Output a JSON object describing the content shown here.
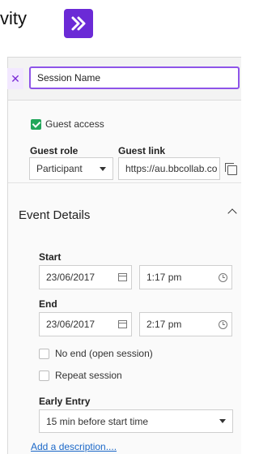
{
  "header": {
    "title_fragment": "vity"
  },
  "session": {
    "name_value": "Session Name"
  },
  "guest": {
    "access_label": "Guest access",
    "role_label": "Guest role",
    "role_value": "Participant",
    "link_label": "Guest link",
    "link_value": "https://au.bbcollab.co"
  },
  "event": {
    "title": "Event Details",
    "start_label": "Start",
    "start_date": "23/06/2017",
    "start_time": "1:17 pm",
    "end_label": "End",
    "end_date": "23/06/2017",
    "end_time": "2:17 pm",
    "no_end_label": "No end (open session)",
    "repeat_label": "Repeat session",
    "early_entry_label": "Early Entry",
    "early_entry_value": "15 min before start time",
    "add_description": "Add a description...."
  },
  "colors": {
    "accent": "#7B2CD6",
    "check": "#22A65A",
    "link": "#1B68C8"
  },
  "icons": [
    "close-icon",
    "check-icon",
    "chevron-down-icon",
    "copy-icon",
    "chevron-up-icon",
    "calendar-icon",
    "clock-icon",
    "app-chevron-icon"
  ]
}
